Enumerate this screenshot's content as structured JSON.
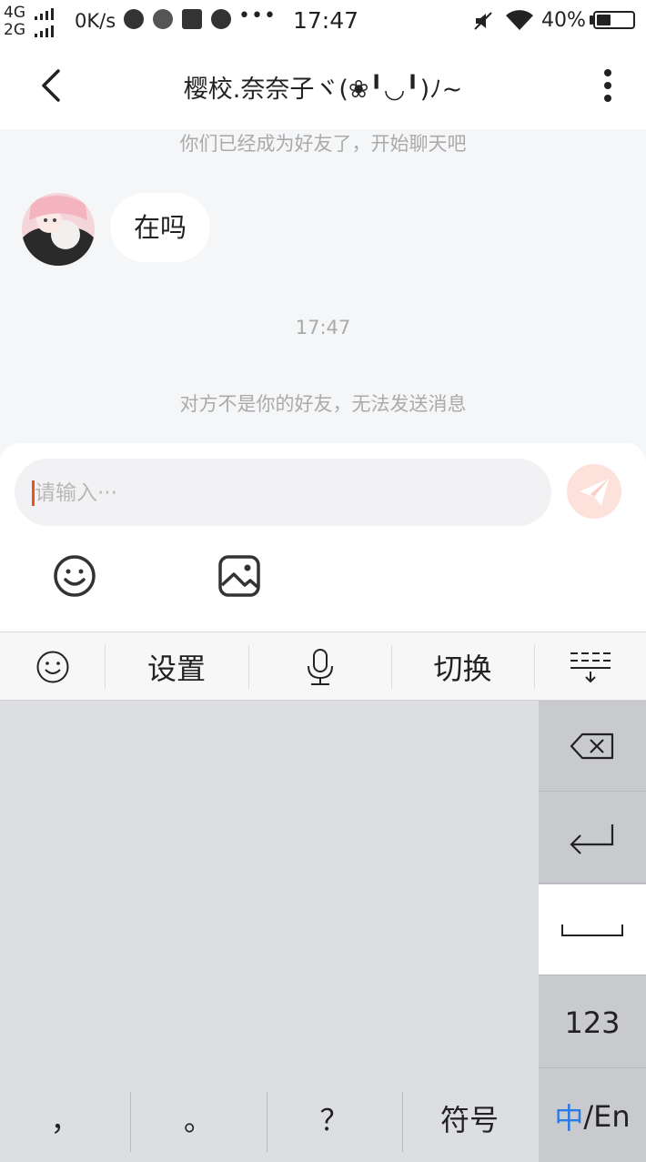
{
  "status_bar": {
    "network_1": "4G",
    "network_2": "2G",
    "speed": "0K/s",
    "more": "•••",
    "time": "17:47",
    "battery_pct": "40%",
    "battery_level": 0.4
  },
  "header": {
    "title": "樱校.奈奈子ヾ(❀╹◡╹)ﾉ~"
  },
  "chat": {
    "friend_notice": "你们已经成为好友了，开始聊天吧",
    "messages": [
      {
        "sender": "other",
        "text": "在吗"
      }
    ],
    "timestamp": "17:47",
    "not_friend_notice": "对方不是你的好友，无法发送消息"
  },
  "input": {
    "placeholder": "请输入···"
  },
  "keyboard_toolbar": {
    "settings": "设置",
    "switch": "切换"
  },
  "keyboard": {
    "num_key": "123",
    "lang_zh": "中",
    "lang_en": "/En",
    "comma": "，",
    "period": "。",
    "question": "？",
    "symbols": "符号"
  }
}
